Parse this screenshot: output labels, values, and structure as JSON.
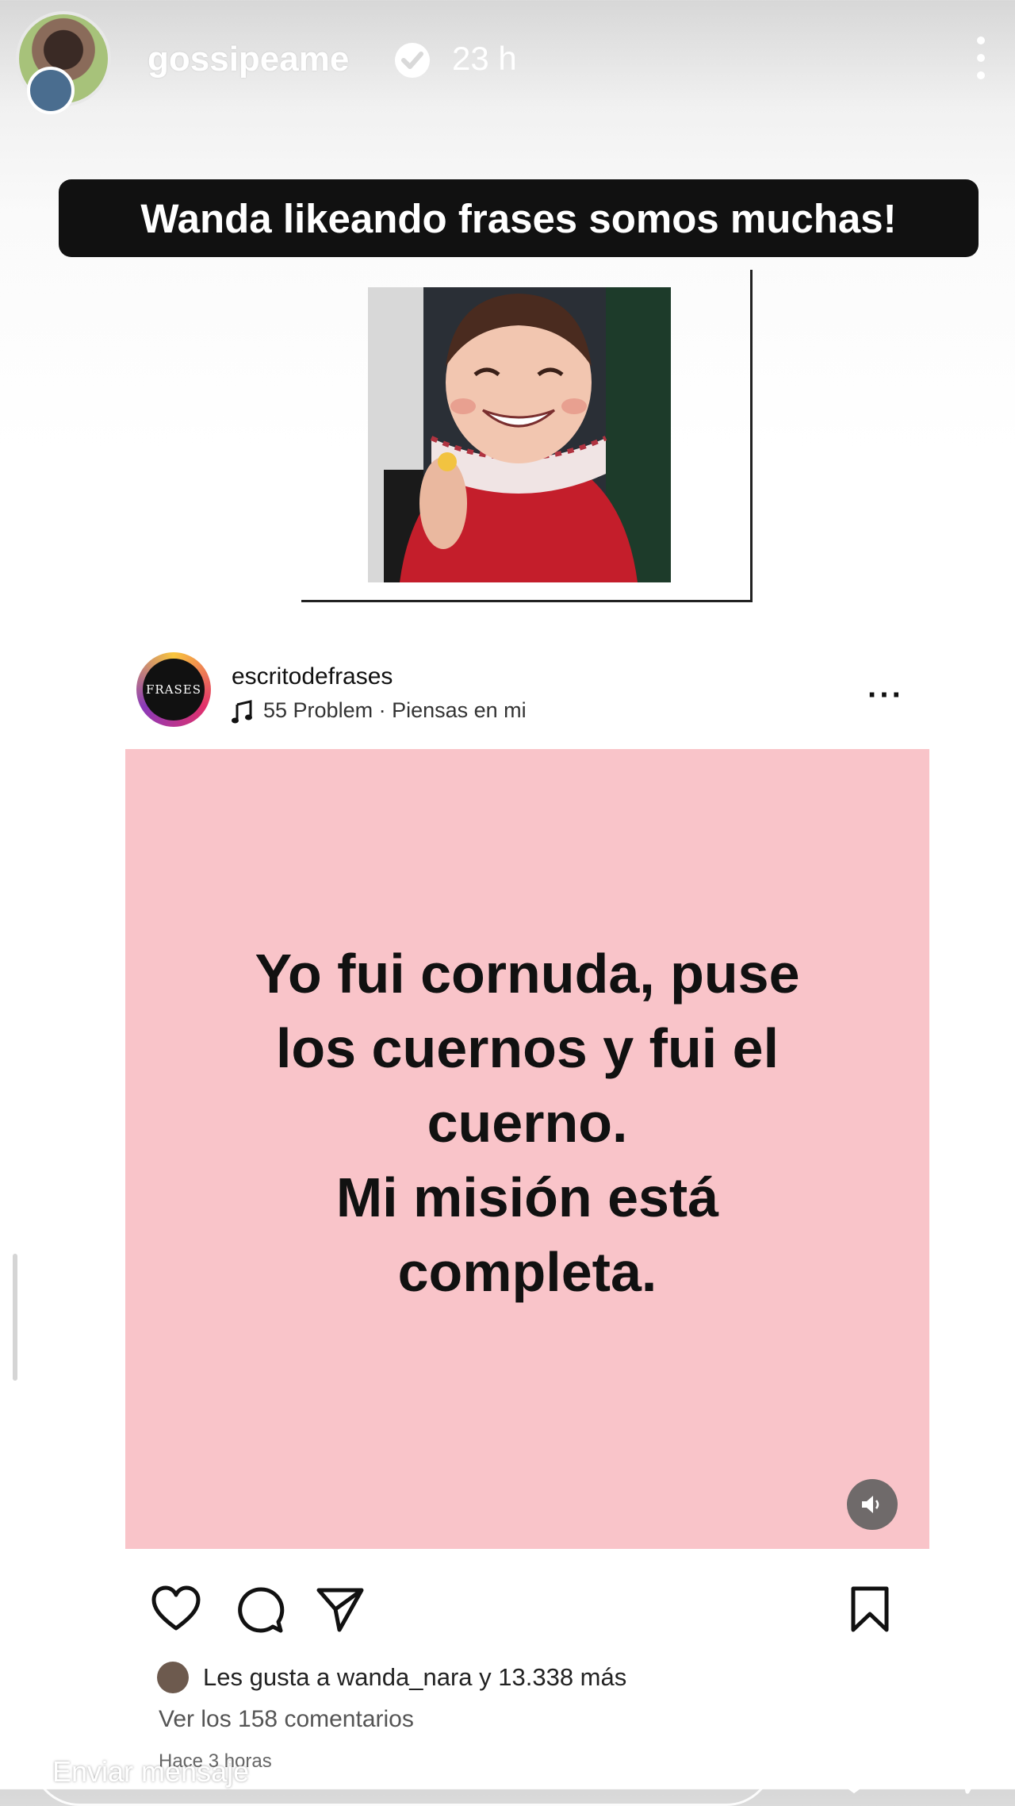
{
  "header": {
    "username": "gossipeame",
    "time": "23 h"
  },
  "caption": "Wanda likeando frases somos muchas!",
  "embedded_post": {
    "avatar_text": "FRASES",
    "username": "escritodefrases",
    "song": "55 Problem · Piensas en mi",
    "quote_lines": [
      "Yo fui cornuda, puse",
      "los cuernos y fui el",
      "cuerno.",
      "Mi misión está",
      "completa."
    ],
    "likes_text": "Les gusta a wanda_nara y 13.338 más",
    "comments_link": "Ver los 158 comentarios",
    "time": "Hace 3 horas"
  },
  "footer": {
    "message_placeholder": "Enviar mensaje"
  },
  "colors": {
    "card_pink": "#f9c4c9",
    "caption_bg": "#111111"
  }
}
